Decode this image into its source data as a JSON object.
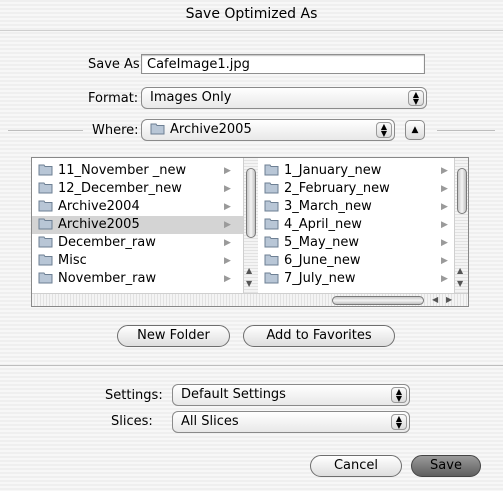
{
  "window": {
    "title": "Save Optimized As"
  },
  "save_as": {
    "label": "Save As:",
    "value": "CafeImage1.jpg"
  },
  "format": {
    "label": "Format:",
    "value": "Images Only"
  },
  "where": {
    "label": "Where:",
    "value": "Archive2005"
  },
  "browser": {
    "col1": [
      {
        "name": "11_November _new",
        "selected": false
      },
      {
        "name": "12_December_new",
        "selected": false
      },
      {
        "name": "Archive2004",
        "selected": false
      },
      {
        "name": "Archive2005",
        "selected": true
      },
      {
        "name": "December_raw",
        "selected": false
      },
      {
        "name": "Misc",
        "selected": false
      },
      {
        "name": "November_raw",
        "selected": false
      }
    ],
    "col2": [
      {
        "name": "1_January_new"
      },
      {
        "name": "2_February_new"
      },
      {
        "name": "3_March_new"
      },
      {
        "name": "4_April_new"
      },
      {
        "name": "5_May_new"
      },
      {
        "name": "6_June_new"
      },
      {
        "name": "7_July_new"
      }
    ]
  },
  "buttons": {
    "new_folder": "New Folder",
    "add_favorites": "Add to Favorites",
    "cancel": "Cancel",
    "save": "Save"
  },
  "settings": {
    "label": "Settings:",
    "value": "Default Settings"
  },
  "slices": {
    "label": "Slices:",
    "value": "All Slices"
  },
  "colors": {
    "selection": "#d4d4d4",
    "folder": "#b8c6d6",
    "default_button": "#6e6e6e"
  }
}
